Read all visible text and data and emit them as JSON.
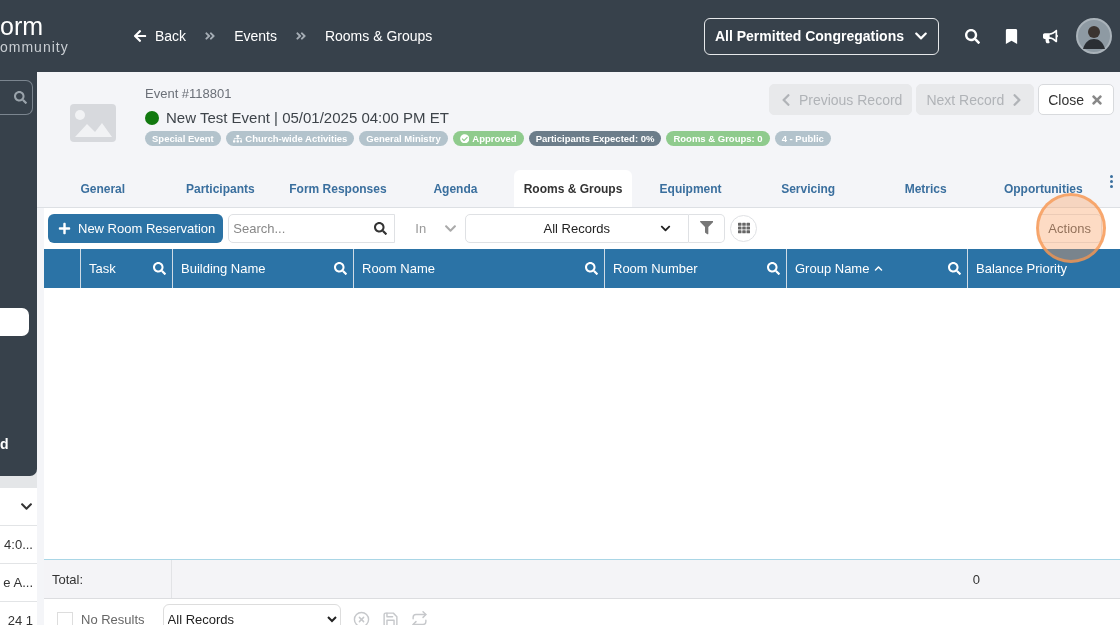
{
  "brand": {
    "name": "orm",
    "tagline": "ommunity"
  },
  "breadcrumb": {
    "back": "Back",
    "items": [
      "Events",
      "Rooms & Groups"
    ]
  },
  "congregation_select": {
    "value": "All Permitted Congregations"
  },
  "sidebar": {
    "label": "d",
    "items": [
      "4:0...",
      "e A...",
      "24 1"
    ]
  },
  "record": {
    "number": "Event #118801",
    "color": "#12790f",
    "title": "New Test Event | 05/01/2025 04:00 PM ET",
    "tags": [
      {
        "label": "Special Event",
        "kind": "plain",
        "color": "#b3c3cc"
      },
      {
        "label": "Church-wide Activities",
        "kind": "category",
        "color": "#b3c3cc"
      },
      {
        "label": "General Ministry",
        "kind": "plain",
        "color": "#b3c3cc"
      },
      {
        "label": "Approved",
        "kind": "approved",
        "color": "#8fcb8d"
      },
      {
        "label": "Participants Expected: 0%",
        "kind": "plain",
        "color": "#6c7d8a"
      },
      {
        "label": "Rooms & Groups: 0",
        "kind": "plain",
        "color": "#8fcb8d"
      },
      {
        "label": "4 - Public",
        "kind": "plain",
        "color": "#b3c3cc"
      }
    ]
  },
  "record_buttons": [
    {
      "label": "Previous Record",
      "kind": "previous",
      "disabled": true
    },
    {
      "label": "Next Record",
      "kind": "next",
      "disabled": true
    },
    {
      "label": "Close",
      "kind": "close",
      "disabled": false
    }
  ],
  "tabs": [
    {
      "label": "General",
      "selected": false
    },
    {
      "label": "Participants",
      "selected": false
    },
    {
      "label": "Form Responses",
      "selected": false
    },
    {
      "label": "Agenda",
      "selected": false
    },
    {
      "label": "Rooms & Groups",
      "selected": true
    },
    {
      "label": "Equipment",
      "selected": false
    },
    {
      "label": "Servicing",
      "selected": false
    },
    {
      "label": "Metrics",
      "selected": false
    },
    {
      "label": "Opportunities",
      "selected": false
    }
  ],
  "toolbar": {
    "new_button": "New Room Reservation",
    "search_placeholder": "Search...",
    "scope": "In",
    "records_filter": "All Records",
    "actions": "Actions"
  },
  "table": {
    "columns": [
      {
        "label": "Task"
      },
      {
        "label": "Building Name"
      },
      {
        "label": "Room Name"
      },
      {
        "label": "Room Number"
      },
      {
        "label": "Group Name",
        "sorted_ascending": true
      },
      {
        "label": "Balance Priority"
      }
    ],
    "total_label": "Total:",
    "total_value": "0"
  },
  "footer": {
    "select_all_checked": false,
    "results": "No Results",
    "view": "All Records"
  }
}
